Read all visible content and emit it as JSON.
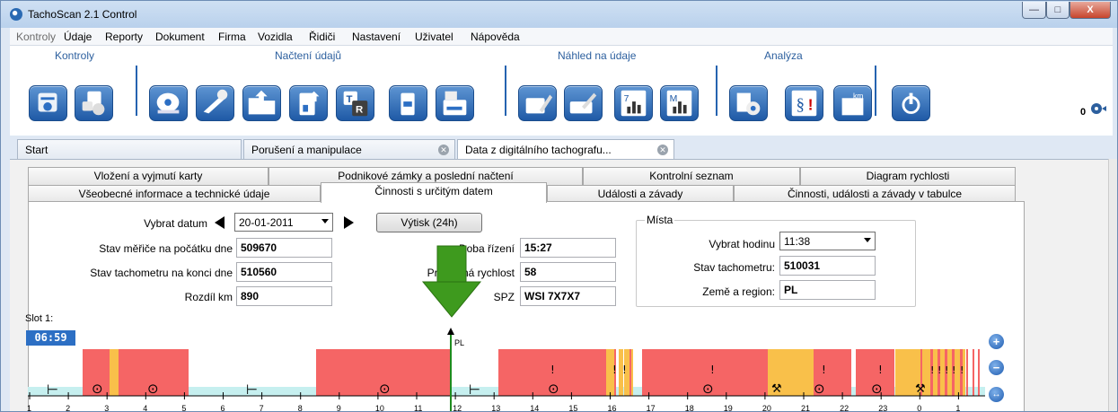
{
  "window": {
    "title": "TachoScan 2.1 Control"
  },
  "menu": [
    "Kontroly",
    "Údaje",
    "Reporty",
    "Dokument",
    "Firma",
    "Vozidla",
    "Řidiči",
    "Nastavení",
    "Uživatel",
    "Nápověda"
  ],
  "ribbon": {
    "groups": [
      "Kontroly",
      "Načtení údajů",
      "Náhled na údaje",
      "Analýza"
    ],
    "button_icons": [
      "driver-card-icon",
      "locked-driver-icon",
      "disc-scan-icon",
      "scanner-settings-icon",
      "open-folder-icon",
      "download-card-icon",
      "tachograph-r-icon",
      "usb-download-icon",
      "card-reader-icon",
      "card-edit-icon",
      "card-edit-2-icon",
      "weekly-chart-icon",
      "monthly-chart-icon",
      "report-disc-icon",
      "infringement-paragraph-icon",
      "km-book-icon",
      "power-icon"
    ],
    "counter": "0"
  },
  "doc_tabs": [
    "Start",
    "Porušení a manipulace",
    "Data z digitálního tachografu..."
  ],
  "sub_tabs_row1": [
    "Vložení a vyjmutí karty",
    "Podnikové zámky a poslední načtení",
    "Kontrolní seznam",
    "Diagram rychlosti"
  ],
  "sub_tabs_row2": [
    "Všeobecné informace a technické údaje",
    "Činnosti s určitým datem",
    "Události a závady",
    "Činnosti, události a závady v tabulce"
  ],
  "form": {
    "date_label": "Vybrat datum",
    "date_value": "20-01-2011",
    "print_button": "Výtisk (24h)",
    "odo_start_label": "Stav měřiče na počátku dne",
    "odo_start_value": "509670",
    "odo_end_label": "Stav tachometru na konci dne",
    "odo_end_value": "510560",
    "diff_label": "Rozdíl km",
    "diff_value": "890",
    "drive_time_label": "Doba řízení",
    "drive_time_value": "15:27",
    "avg_speed_label": "Průměrná rychlost",
    "avg_speed_value": "58",
    "plate_label": "SPZ",
    "plate_value": "WSI 7X7X7"
  },
  "places": {
    "title": "Místa",
    "hour_label": "Vybrat hodinu",
    "hour_value": "11:38",
    "odo_label": "Stav tachometru:",
    "odo_value": "510031",
    "country_label": "Země a region:",
    "country_value": "PL"
  },
  "chart_data": {
    "type": "timeline",
    "slot_label": "Slot 1:",
    "cursor_time": "06:59",
    "marker_label": "PL",
    "ticks": [
      "1",
      "2",
      "3",
      "4",
      "5",
      "6",
      "7",
      "8",
      "9",
      "10",
      "11",
      "12",
      "13",
      "14",
      "15",
      "16",
      "17",
      "18",
      "19",
      "20",
      "21",
      "22",
      "23",
      "0",
      "1"
    ],
    "colors": {
      "driving": "#f56565",
      "other_work": "#f9c04a",
      "rest": "#c6efef"
    }
  }
}
